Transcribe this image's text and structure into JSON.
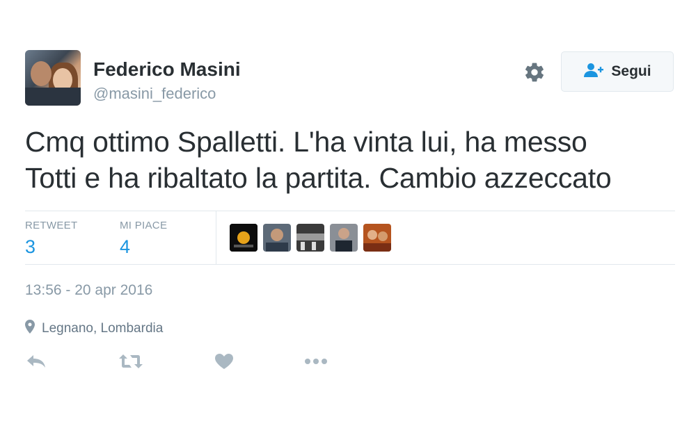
{
  "user": {
    "name": "Federico Masini",
    "handle": "@masini_federico"
  },
  "follow_button": {
    "label": "Segui",
    "icon": "add-user-icon"
  },
  "settings": {
    "icon": "gear-icon"
  },
  "tweet": {
    "line1": "Cmq ottimo Spalletti. L'ha vinta lui, ha messo",
    "line2": "Totti e ha ribaltato la partita. Cambio azzeccato"
  },
  "stats": {
    "retweets_label": "RETWEET",
    "retweets_value": "3",
    "likes_label": "MI PIACE",
    "likes_value": "4"
  },
  "likers": [
    {
      "icon": "liker-avatar-1"
    },
    {
      "icon": "liker-avatar-2"
    },
    {
      "icon": "liker-avatar-3"
    },
    {
      "icon": "liker-avatar-4"
    },
    {
      "icon": "liker-avatar-5"
    }
  ],
  "timestamp": "13:56 - 20 apr 2016",
  "location": {
    "label": "Legnano, Lombardia",
    "icon": "location-pin-icon"
  },
  "actions": [
    {
      "icon": "reply-icon"
    },
    {
      "icon": "retweet-icon"
    },
    {
      "icon": "heart-icon"
    },
    {
      "icon": "more-icon"
    }
  ],
  "colors": {
    "text": "#292f33",
    "muted": "#8899a6",
    "accent": "#1b95e0",
    "border": "#e1e8ed"
  }
}
